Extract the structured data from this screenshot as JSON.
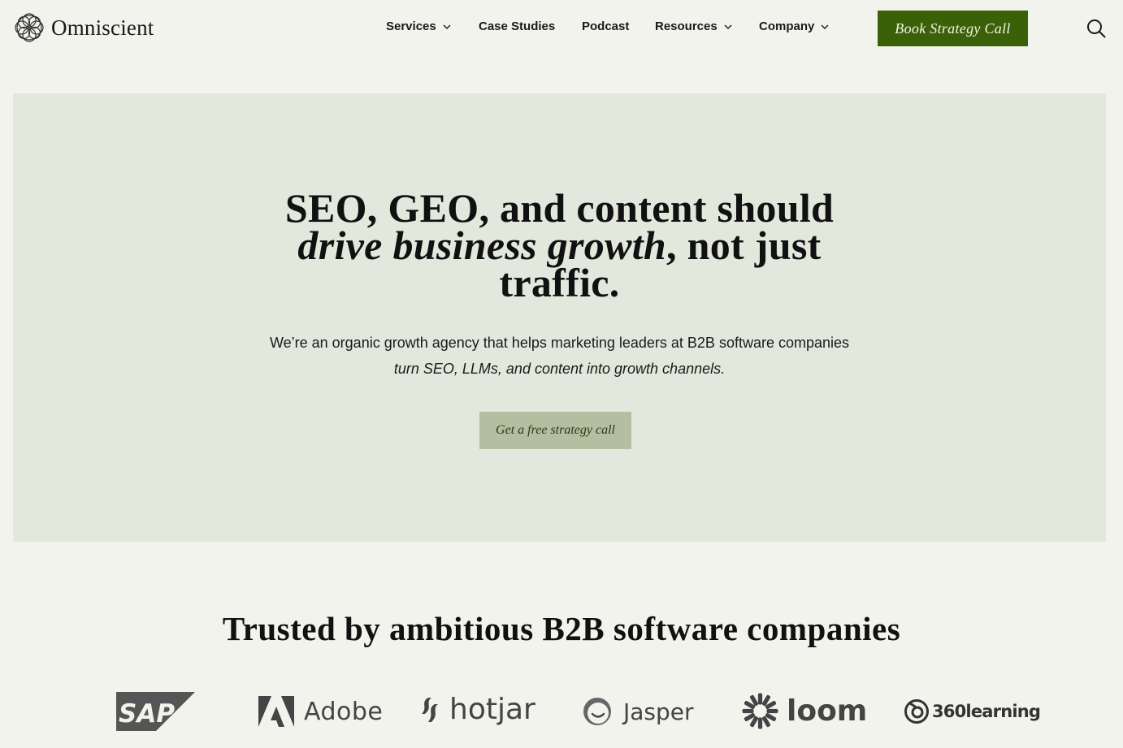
{
  "header": {
    "logo_text": "Omniscient",
    "nav": [
      {
        "label": "Services",
        "dropdown": true
      },
      {
        "label": "Case Studies",
        "dropdown": false
      },
      {
        "label": "Podcast",
        "dropdown": false
      },
      {
        "label": "Resources",
        "dropdown": true
      },
      {
        "label": "Company",
        "dropdown": true
      }
    ],
    "cta_label": "Book Strategy Call",
    "search_icon": "search-icon"
  },
  "hero": {
    "title_line1": "SEO, GEO, and content should",
    "title_italic": "drive business growth",
    "title_after_italic": ", not just",
    "title_line3": "traffic.",
    "subtitle_line1": "We’re an organic growth agency that helps marketing leaders at B2B software companies",
    "subtitle_line2": "turn SEO, LLMs, and content into growth channels.",
    "cta_label": "Get a free strategy call"
  },
  "trusted": {
    "title": "Trusted by ambitious B2B software companies",
    "logos": [
      "SAP",
      "Adobe",
      "hotjar",
      "Jasper",
      "loom",
      "360learning"
    ]
  },
  "colors": {
    "background": "#f1f3ec",
    "hero_bg": "#e3e8dd",
    "primary_cta": "#3b6108",
    "secondary_cta": "#b3bfa0"
  }
}
